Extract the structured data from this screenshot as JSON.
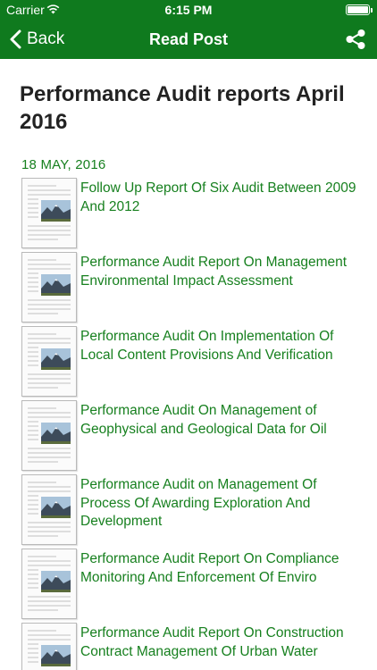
{
  "status_bar": {
    "carrier": "Carrier",
    "time": "6:15 PM",
    "icons": [
      "wifi-icon",
      "battery-icon"
    ]
  },
  "nav": {
    "back_label": "Back",
    "title": "Read Post",
    "back_icon": "chevron-left-icon",
    "share_icon": "share-icon",
    "background": "#0f7a1e"
  },
  "post": {
    "title": "Performance Audit reports April 2016",
    "date": "18 MAY, 2016",
    "link_color": "#17801f",
    "items": [
      {
        "label": "Follow Up Report Of Six Audit Between 2009 And 2012",
        "icon": "document-thumbnail-icon"
      },
      {
        "label": "Performance Audit Report On Management Environmental Impact Assessment",
        "icon": "document-thumbnail-icon"
      },
      {
        "label": "Performance Audit On Implementation Of Local Content Provisions And Verification",
        "icon": "document-thumbnail-icon"
      },
      {
        "label": "Performance Audit On Management of Geophysical and Geological Data for Oil",
        "icon": "document-thumbnail-icon"
      },
      {
        "label": "Performance Audit on Management Of Process Of Awarding Exploration And Development",
        "icon": "document-thumbnail-icon"
      },
      {
        "label": "Performance Audit Report On Compliance Monitoring And Enforcement Of Enviro",
        "icon": "document-thumbnail-icon"
      },
      {
        "label": "Performance Audit Report On Construction Contract Management Of Urban Water",
        "icon": "document-thumbnail-icon"
      }
    ]
  }
}
